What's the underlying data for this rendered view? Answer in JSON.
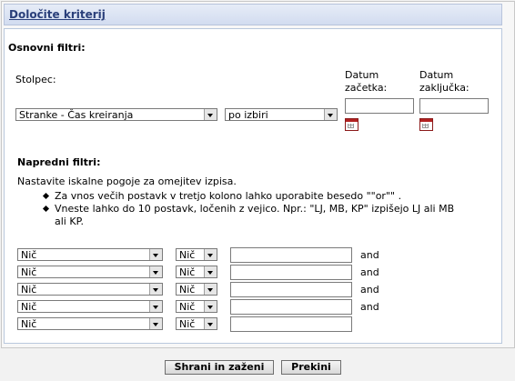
{
  "header": {
    "title": "Določite kriterij"
  },
  "basic": {
    "section_title": "Osnovni filtri:",
    "column_label": "Stolpec:",
    "column_select": "Stranke - Čas kreiranja",
    "mode_select": "po izbiri",
    "date_start_label_1": "Datum",
    "date_start_label_2": "začetka:",
    "date_end_label_1": "Datum",
    "date_end_label_2": "zaključka:",
    "date_start_value": "",
    "date_end_value": ""
  },
  "advanced": {
    "section_title": "Napredni filtri:",
    "intro": "Nastavite iskalne pogoje za omejitev izpisa.",
    "bullet1": "Za vnos večih postavk v tretjo kolono lahko uporabite besedo \"\"or\"\" .",
    "bullet2_line1": "Vneste lahko do 10 postavk, ločenih z vejico. Npr.: \"LJ, MB, KP\" izpišejo LJ ali MB",
    "bullet2_line2": "ali KP.",
    "rows": [
      {
        "field": "Nič",
        "operator": "Nič",
        "value": "",
        "connector": "and"
      },
      {
        "field": "Nič",
        "operator": "Nič",
        "value": "",
        "connector": "and"
      },
      {
        "field": "Nič",
        "operator": "Nič",
        "value": "",
        "connector": "and"
      },
      {
        "field": "Nič",
        "operator": "Nič",
        "value": "",
        "connector": "and"
      },
      {
        "field": "Nič",
        "operator": "Nič",
        "value": "",
        "connector": ""
      }
    ]
  },
  "buttons": {
    "save_run": "Shrani in zaženi",
    "cancel": "Prekini"
  },
  "icons": {
    "calendar": "calendar-icon",
    "dropdown": "chevron-down-icon",
    "bullet": "diamond-bullet"
  }
}
